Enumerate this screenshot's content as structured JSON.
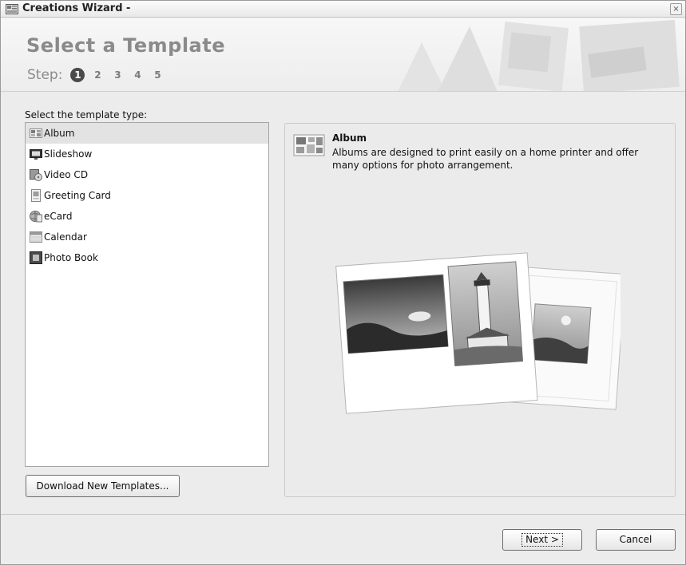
{
  "window": {
    "title": "Creations Wizard -",
    "close_glyph": "×"
  },
  "header": {
    "heading": "Select a Template",
    "step_label": "Step:",
    "steps": [
      "1",
      "2",
      "3",
      "4",
      "5"
    ],
    "active_step": "1"
  },
  "templates": {
    "label": "Select the template type:",
    "items": [
      {
        "label": "Album",
        "icon": "album-icon"
      },
      {
        "label": "Slideshow",
        "icon": "slideshow-icon"
      },
      {
        "label": "Video CD",
        "icon": "video-cd-icon"
      },
      {
        "label": "Greeting Card",
        "icon": "greeting-card-icon"
      },
      {
        "label": "eCard",
        "icon": "ecard-icon"
      },
      {
        "label": "Calendar",
        "icon": "calendar-icon"
      },
      {
        "label": "Photo Book",
        "icon": "photo-book-icon"
      }
    ],
    "selected": "Album"
  },
  "preview": {
    "title": "Album",
    "description": "Albums are designed to print easily on a home printer and offer many options for photo arrangement.",
    "icon": "album-large-icon",
    "image": "album-preview-illustration"
  },
  "buttons": {
    "download": "Download New Templates...",
    "next": "Next >",
    "cancel": "Cancel"
  },
  "colors": {
    "window_bg": "#ececec",
    "selected_row": "#e3e3e3",
    "active_step": "#4a4a4a",
    "heading": "#8a8a8a"
  }
}
